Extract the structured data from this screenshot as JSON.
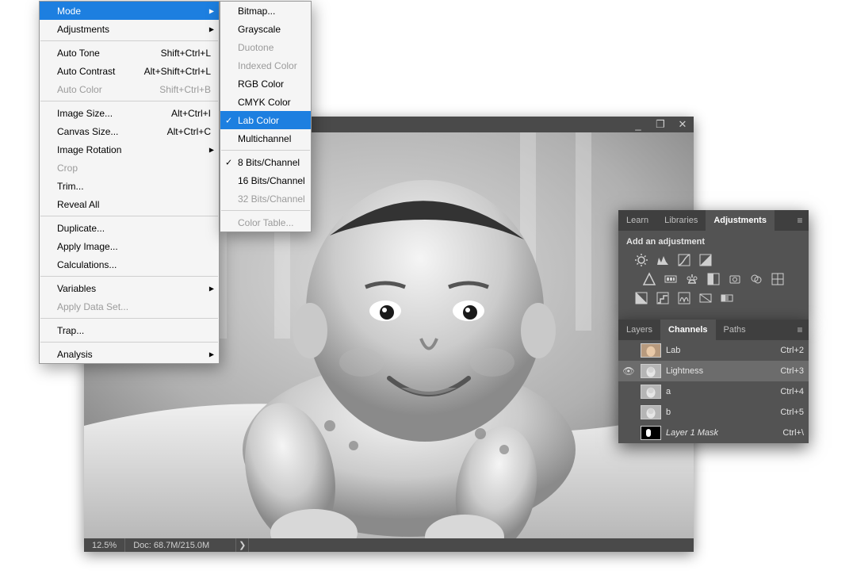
{
  "window": {
    "min_title": "_",
    "max_title": "❐",
    "close_title": "✕"
  },
  "status": {
    "zoom": "12.5%",
    "doc": "Doc: 68.7M/215.0M",
    "chevron": "❯"
  },
  "adjustPanel": {
    "tabs": [
      "Learn",
      "Libraries",
      "Adjustments"
    ],
    "activeTab": 2,
    "title": "Add an adjustment",
    "icons_row1": [
      "brightness",
      "levels",
      "curves",
      "exposure"
    ],
    "icons_row2": [
      "vibrance",
      "hue",
      "color-balance",
      "bw",
      "photo-filter",
      "channel-mixer",
      "lookup"
    ],
    "icons_row3": [
      "invert",
      "posterize",
      "threshold",
      "selective",
      "gradient-map"
    ]
  },
  "channelsPanel": {
    "tabs": [
      "Layers",
      "Channels",
      "Paths"
    ],
    "activeTab": 1,
    "rows": [
      {
        "name": "Lab",
        "shortcut": "Ctrl+2",
        "eye": false,
        "sel": false,
        "italic": false,
        "mask": false
      },
      {
        "name": "Lightness",
        "shortcut": "Ctrl+3",
        "eye": true,
        "sel": true,
        "italic": false,
        "mask": false
      },
      {
        "name": "a",
        "shortcut": "Ctrl+4",
        "eye": false,
        "sel": false,
        "italic": false,
        "mask": false
      },
      {
        "name": "b",
        "shortcut": "Ctrl+5",
        "eye": false,
        "sel": false,
        "italic": false,
        "mask": false
      },
      {
        "name": "Layer 1 Mask",
        "shortcut": "Ctrl+\\",
        "eye": false,
        "sel": false,
        "italic": true,
        "mask": true
      }
    ]
  },
  "imageMenu": [
    {
      "type": "item",
      "label": "Mode",
      "sub": true,
      "highlight": true
    },
    {
      "type": "item",
      "label": "Adjustments",
      "sub": true
    },
    {
      "type": "sep"
    },
    {
      "type": "item",
      "label": "Auto Tone",
      "shortcut": "Shift+Ctrl+L"
    },
    {
      "type": "item",
      "label": "Auto Contrast",
      "shortcut": "Alt+Shift+Ctrl+L"
    },
    {
      "type": "item",
      "label": "Auto Color",
      "shortcut": "Shift+Ctrl+B",
      "disabled": true
    },
    {
      "type": "sep"
    },
    {
      "type": "item",
      "label": "Image Size...",
      "shortcut": "Alt+Ctrl+I"
    },
    {
      "type": "item",
      "label": "Canvas Size...",
      "shortcut": "Alt+Ctrl+C"
    },
    {
      "type": "item",
      "label": "Image Rotation",
      "sub": true
    },
    {
      "type": "item",
      "label": "Crop",
      "disabled": true
    },
    {
      "type": "item",
      "label": "Trim..."
    },
    {
      "type": "item",
      "label": "Reveal All"
    },
    {
      "type": "sep"
    },
    {
      "type": "item",
      "label": "Duplicate..."
    },
    {
      "type": "item",
      "label": "Apply Image..."
    },
    {
      "type": "item",
      "label": "Calculations..."
    },
    {
      "type": "sep"
    },
    {
      "type": "item",
      "label": "Variables",
      "sub": true
    },
    {
      "type": "item",
      "label": "Apply Data Set...",
      "disabled": true
    },
    {
      "type": "sep"
    },
    {
      "type": "item",
      "label": "Trap..."
    },
    {
      "type": "sep"
    },
    {
      "type": "item",
      "label": "Analysis",
      "sub": true
    }
  ],
  "modeMenu": [
    {
      "type": "item",
      "label": "Bitmap..."
    },
    {
      "type": "item",
      "label": "Grayscale"
    },
    {
      "type": "item",
      "label": "Duotone",
      "disabled": true
    },
    {
      "type": "item",
      "label": "Indexed Color",
      "disabled": true
    },
    {
      "type": "item",
      "label": "RGB Color"
    },
    {
      "type": "item",
      "label": "CMYK Color"
    },
    {
      "type": "item",
      "label": "Lab Color",
      "check": true,
      "highlight": true
    },
    {
      "type": "item",
      "label": "Multichannel"
    },
    {
      "type": "sep"
    },
    {
      "type": "item",
      "label": "8 Bits/Channel",
      "check": true
    },
    {
      "type": "item",
      "label": "16 Bits/Channel"
    },
    {
      "type": "item",
      "label": "32 Bits/Channel",
      "disabled": true
    },
    {
      "type": "sep"
    },
    {
      "type": "item",
      "label": "Color Table...",
      "disabled": true
    }
  ]
}
